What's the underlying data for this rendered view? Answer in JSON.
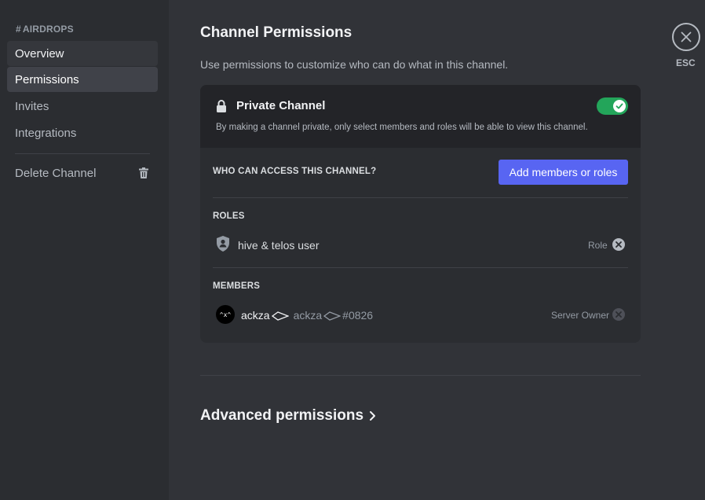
{
  "sidebar": {
    "channel_hash": "#",
    "channel_name": "AIRDROPS",
    "items": [
      {
        "label": "Overview"
      },
      {
        "label": "Permissions"
      },
      {
        "label": "Invites"
      },
      {
        "label": "Integrations"
      }
    ],
    "delete_label": "Delete Channel"
  },
  "main": {
    "title": "Channel Permissions",
    "description": "Use permissions to customize who can do what in this channel.",
    "private_channel": {
      "title": "Private Channel",
      "description": "By making a channel private, only select members and roles will be able to view this channel.",
      "enabled": true
    },
    "access": {
      "label": "WHO CAN ACCESS THIS CHANNEL?",
      "add_button": "Add members or roles"
    },
    "roles": {
      "label": "ROLES",
      "items": [
        {
          "name": "hive & telos user",
          "tag": "Role"
        }
      ]
    },
    "members": {
      "label": "MEMBERS",
      "items": [
        {
          "avatar_text": "^x^",
          "display_name": "ackza",
          "username": "ackza",
          "discriminator": "#0826",
          "tag": "Server Owner"
        }
      ]
    },
    "advanced": {
      "label": "Advanced permissions"
    }
  },
  "close": {
    "esc_label": "ESC"
  },
  "colors": {
    "accent": "#5865f2",
    "toggle_on": "#23a55a",
    "sidebar_bg": "#2b2d31",
    "main_bg": "#313338"
  },
  "icons": {
    "lock": "lock-icon",
    "trash": "trash-icon",
    "role": "shield-person-icon",
    "close": "close-icon",
    "chevron": "chevron-right-icon",
    "check": "check-icon"
  }
}
